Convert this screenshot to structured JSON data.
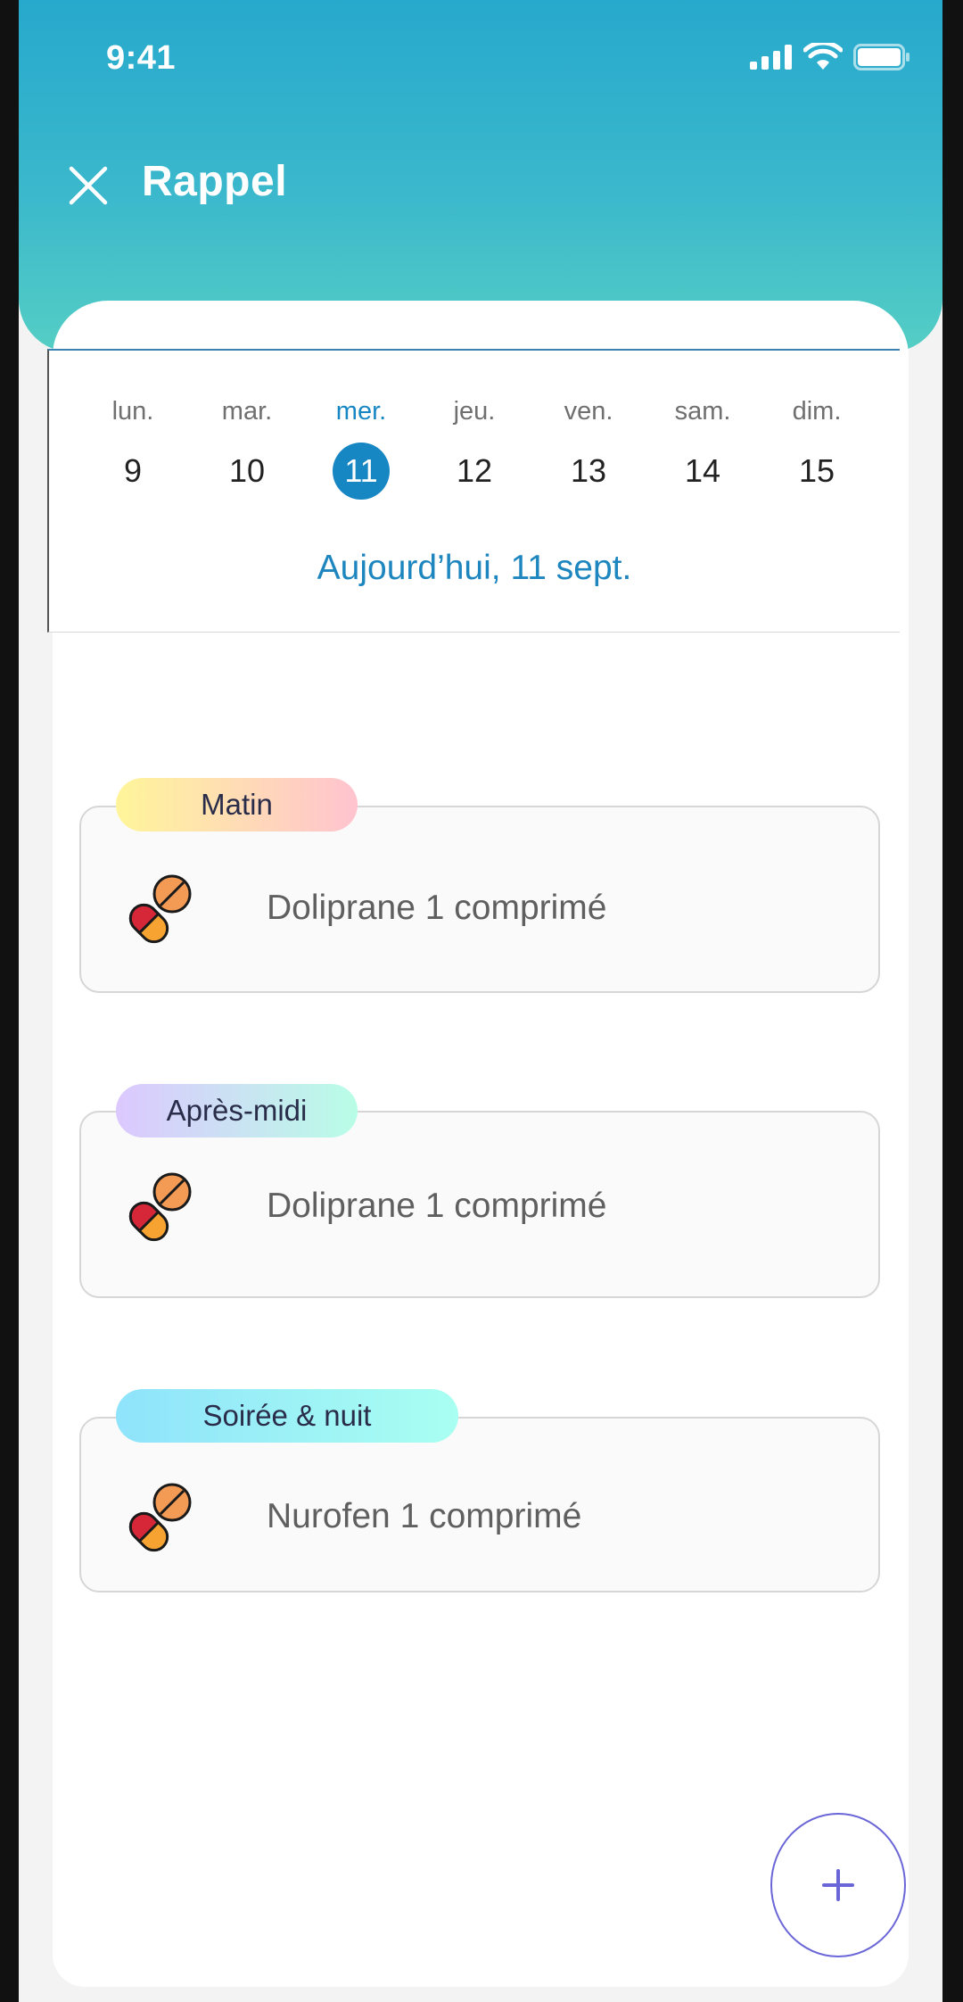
{
  "status_bar": {
    "time": "9:41",
    "icons": [
      "signal-icon",
      "wifi-icon",
      "battery-icon"
    ]
  },
  "header": {
    "title": "Rappel",
    "close_icon": "close-icon"
  },
  "calendar": {
    "days": [
      {
        "name": "lun.",
        "number": "9"
      },
      {
        "name": "mar.",
        "number": "10"
      },
      {
        "name": "mer.",
        "number": "11"
      },
      {
        "name": "jeu.",
        "number": "12"
      },
      {
        "name": "ven.",
        "number": "13"
      },
      {
        "name": "sam.",
        "number": "14"
      },
      {
        "name": "dim.",
        "number": "15"
      }
    ],
    "selected_index": 2,
    "today_label": "Aujourd’hui, 11 sept."
  },
  "slots": [
    {
      "label": "Matin",
      "medication": "Doliprane 1 comprimé",
      "icon": "pill-icon"
    },
    {
      "label": "Après-midi",
      "medication": "Doliprane 1 comprimé",
      "icon": "pill-icon"
    },
    {
      "label": "Soirée & nuit",
      "medication": "Nurofen 1 comprimé",
      "icon": "pill-icon"
    }
  ],
  "fab": {
    "label": "+",
    "icon": "plus-icon"
  },
  "colors": {
    "header_gradient_top": "#27a9cd",
    "header_gradient_bottom": "#55cec4",
    "accent": "#1787c3",
    "fab_border": "#6a66d8"
  }
}
